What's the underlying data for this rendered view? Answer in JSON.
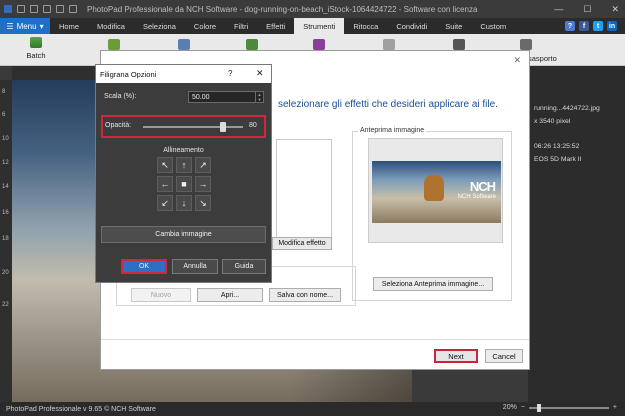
{
  "window": {
    "title": "PhotoPad Professionale da NCH Software - dog-running-on-beach_iStock-1064424722 - Software con licenza",
    "minimize": "—",
    "maximize": "☐",
    "close": "✕"
  },
  "ribbon": {
    "menu_label": "Menu",
    "tabs": [
      "Home",
      "Modifica",
      "Seleziona",
      "Colore",
      "Filtri",
      "Effetti",
      "Strumenti",
      "Ritocca",
      "Condividi",
      "Suite",
      "Custom"
    ],
    "active_tab": "Strumenti",
    "batch_label": "Batch",
    "toolbar_partial_label": "sasporto"
  },
  "social": [
    "?",
    "f",
    "t",
    "in"
  ],
  "colors": {
    "accent": "#1e6fc8",
    "highlight": "#d0273e",
    "heading_blue": "#1b4f99"
  },
  "ruler": [
    "8",
    "6",
    "10",
    "12",
    "14",
    "16",
    "18",
    "20",
    "22"
  ],
  "file_info": {
    "filename": "running...4424722.jpg",
    "size": "x 3540 pixel",
    "date": "06:26 13:25:52",
    "camera": "EOS 5D Mark II"
  },
  "wizard": {
    "heading": "selezionare gli effetti che desideri applicare ai file.",
    "modify_effect": "Modifica effetto",
    "new": "Nuovo",
    "open": "Apri...",
    "save_as": "Salva con nome...",
    "preview_label": "Anteprima immagine",
    "preview_select": "Seleziona Anteprima immagine...",
    "next": "Next",
    "cancel": "Cancel"
  },
  "preview_watermark": {
    "logo": "NCH",
    "sub": "NCH Software"
  },
  "watermark_dialog": {
    "title": "Filigrana Opzioni",
    "help": "?",
    "close": "✕",
    "scale_label": "Scala (%):",
    "scale_value": "50.00",
    "opacity_label": "Opacità:",
    "opacity_value": "80",
    "opacity_fraction": 0.8,
    "alignment_title": "Allineamento",
    "alignment_arrows": [
      "↖",
      "↑",
      "↗",
      "←",
      "■",
      "→",
      "↙",
      "↓",
      "↘"
    ],
    "change_image": "Cambia immagine",
    "ok": "OK",
    "cancel": "Annulla",
    "guide": "Guida"
  },
  "status": {
    "text": "PhotoPad Professionale v 9.65 © NCH Software",
    "zoom": "20%"
  }
}
